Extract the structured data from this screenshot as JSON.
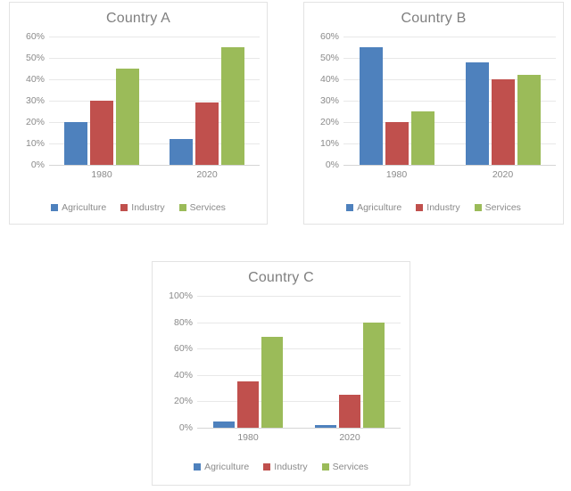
{
  "page": {
    "background": "#ffffff",
    "series_colors": {
      "Agriculture": "#4e81bd",
      "Industry": "#c0504d",
      "Services": "#9bbb59"
    },
    "axis_text_color": "#8a8a8a",
    "title_color": "#7f7f7f",
    "grid_color": "#e8e8e8",
    "panel_border_color": "#e3e3e3"
  },
  "panels": [
    {
      "id": "a",
      "title": "Country A"
    },
    {
      "id": "b",
      "title": "Country B"
    },
    {
      "id": "c",
      "title": "Country C"
    }
  ],
  "legend": {
    "items": [
      {
        "label": "Agriculture",
        "color": "#4e81bd"
      },
      {
        "label": "Industry",
        "color": "#c0504d"
      },
      {
        "label": "Services",
        "color": "#9bbb59"
      }
    ]
  },
  "chart_data": [
    {
      "type": "bar",
      "title": "Country A",
      "xlabel": "",
      "ylabel": "",
      "categories": [
        "1980",
        "2020"
      ],
      "series": [
        {
          "name": "Agriculture",
          "color": "#4e81bd",
          "values": [
            20,
            12
          ]
        },
        {
          "name": "Industry",
          "color": "#c0504d",
          "values": [
            30,
            29
          ]
        },
        {
          "name": "Services",
          "color": "#9bbb59",
          "values": [
            45,
            55
          ]
        }
      ],
      "ylim": [
        0,
        60
      ],
      "ytick_step": 10,
      "ytick_labels": [
        "0%",
        "10%",
        "20%",
        "30%",
        "40%",
        "50%",
        "60%"
      ],
      "ytick_values": [
        0,
        10,
        20,
        30,
        40,
        50,
        60
      ],
      "grid": true,
      "legend_position": "bottom",
      "value_suffix": "%"
    },
    {
      "type": "bar",
      "title": "Country B",
      "xlabel": "",
      "ylabel": "",
      "categories": [
        "1980",
        "2020"
      ],
      "series": [
        {
          "name": "Agriculture",
          "color": "#4e81bd",
          "values": [
            55,
            48
          ]
        },
        {
          "name": "Industry",
          "color": "#c0504d",
          "values": [
            20,
            40
          ]
        },
        {
          "name": "Services",
          "color": "#9bbb59",
          "values": [
            25,
            42
          ]
        }
      ],
      "ylim": [
        0,
        60
      ],
      "ytick_step": 10,
      "ytick_labels": [
        "0%",
        "10%",
        "20%",
        "30%",
        "40%",
        "50%",
        "60%"
      ],
      "ytick_values": [
        0,
        10,
        20,
        30,
        40,
        50,
        60
      ],
      "grid": true,
      "legend_position": "bottom",
      "value_suffix": "%"
    },
    {
      "type": "bar",
      "title": "Country C",
      "xlabel": "",
      "ylabel": "",
      "categories": [
        "1980",
        "2020"
      ],
      "series": [
        {
          "name": "Agriculture",
          "color": "#4e81bd",
          "values": [
            5,
            2
          ]
        },
        {
          "name": "Industry",
          "color": "#c0504d",
          "values": [
            35,
            25
          ]
        },
        {
          "name": "Services",
          "color": "#9bbb59",
          "values": [
            69,
            80
          ]
        }
      ],
      "ylim": [
        0,
        100
      ],
      "ytick_step": 20,
      "ytick_labels": [
        "0%",
        "20%",
        "40%",
        "60%",
        "80%",
        "100%"
      ],
      "ytick_values": [
        0,
        20,
        40,
        60,
        80,
        100
      ],
      "grid": true,
      "legend_position": "bottom",
      "value_suffix": "%"
    }
  ]
}
